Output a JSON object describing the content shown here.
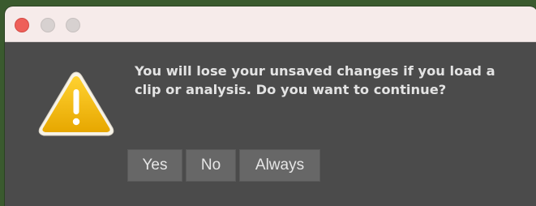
{
  "dialog": {
    "message_line1": "You will lose your unsaved changes if you load a",
    "message_line2": "clip or analysis. Do you want to continue?",
    "icon": "warning-icon",
    "buttons": {
      "yes": "Yes",
      "no": "No",
      "always": "Always"
    }
  },
  "window": {
    "controls": [
      "close",
      "minimize",
      "maximize"
    ]
  },
  "colors": {
    "dialog_background": "#4b4b4b",
    "titlebar_background": "#f6ebea",
    "close_button": "#ee5f59",
    "inactive_window_button": "#d7d1d0",
    "button_background": "#676767",
    "warning_yellow": "#f0b400",
    "text": "#e3e3e3"
  }
}
